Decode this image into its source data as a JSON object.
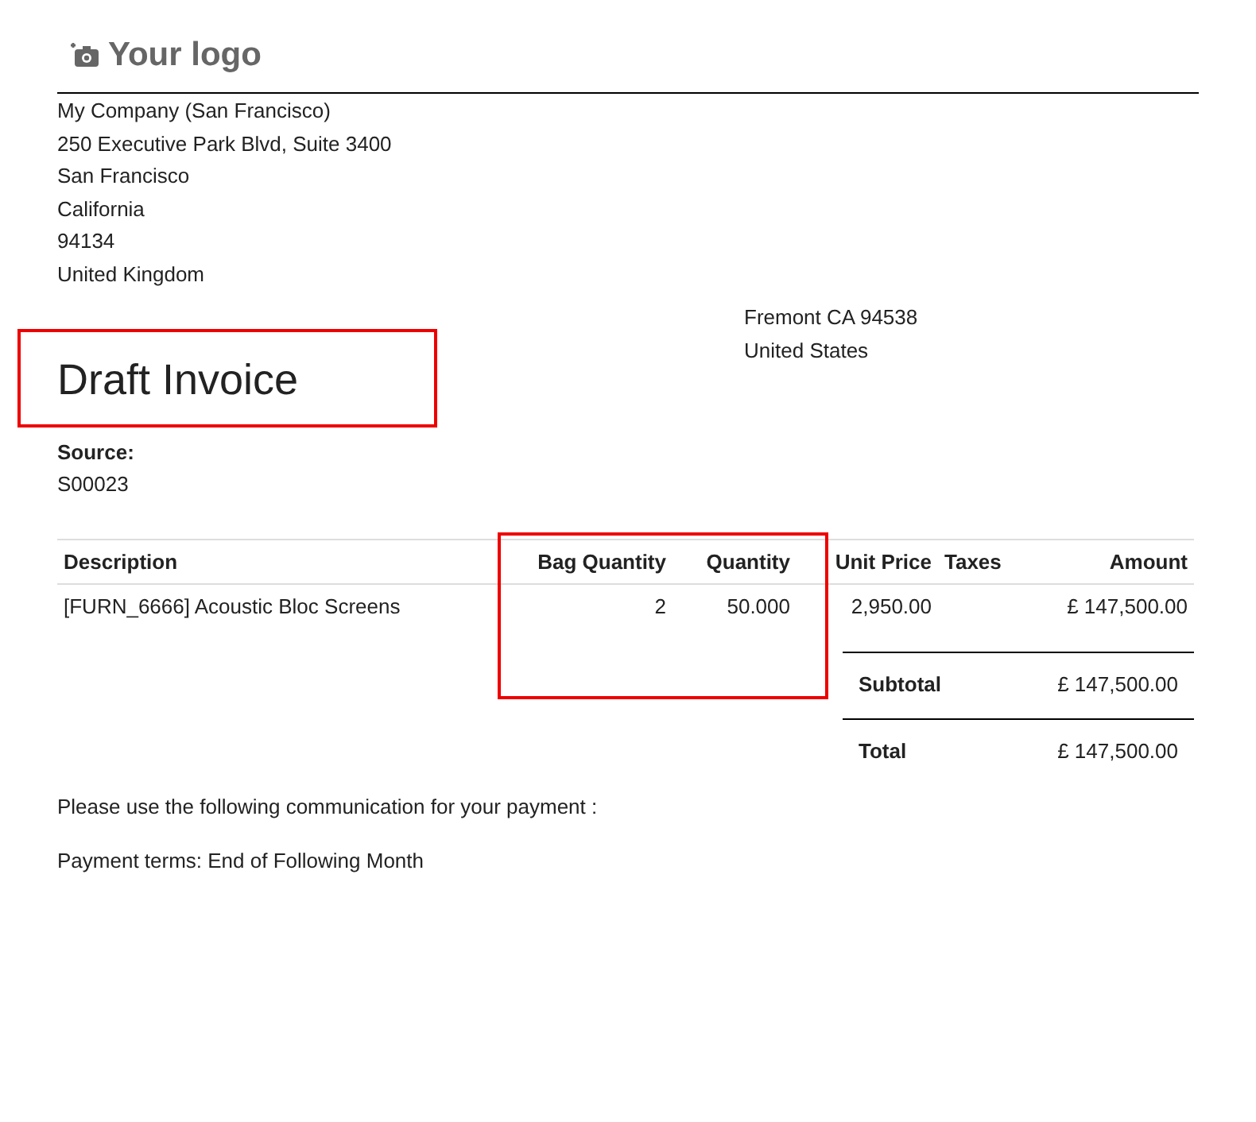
{
  "logo": {
    "text": "Your logo"
  },
  "company_address": [
    "My Company (San Francisco)",
    "250 Executive Park Blvd, Suite 3400",
    "San Francisco",
    "California",
    "94134",
    "United Kingdom"
  ],
  "customer_address": [
    "Fremont CA 94538",
    "United States"
  ],
  "title": "Draft Invoice",
  "source": {
    "label": "Source:",
    "value": "S00023"
  },
  "table": {
    "columns": [
      "Description",
      "Bag Quantity",
      "Quantity",
      "Unit Price",
      "Taxes",
      "Amount"
    ],
    "rows": [
      [
        "[FURN_6666] Acoustic Bloc Screens",
        "2",
        "50.000",
        "2,950.00",
        "",
        "£ 147,500.00"
      ]
    ]
  },
  "totals": [
    {
      "label": "Subtotal",
      "value": "£ 147,500.00"
    },
    {
      "label": "Total",
      "value": "£ 147,500.00"
    }
  ],
  "notes": [
    "Please use the following communication for your payment :",
    "Payment terms: End of Following Month"
  ]
}
